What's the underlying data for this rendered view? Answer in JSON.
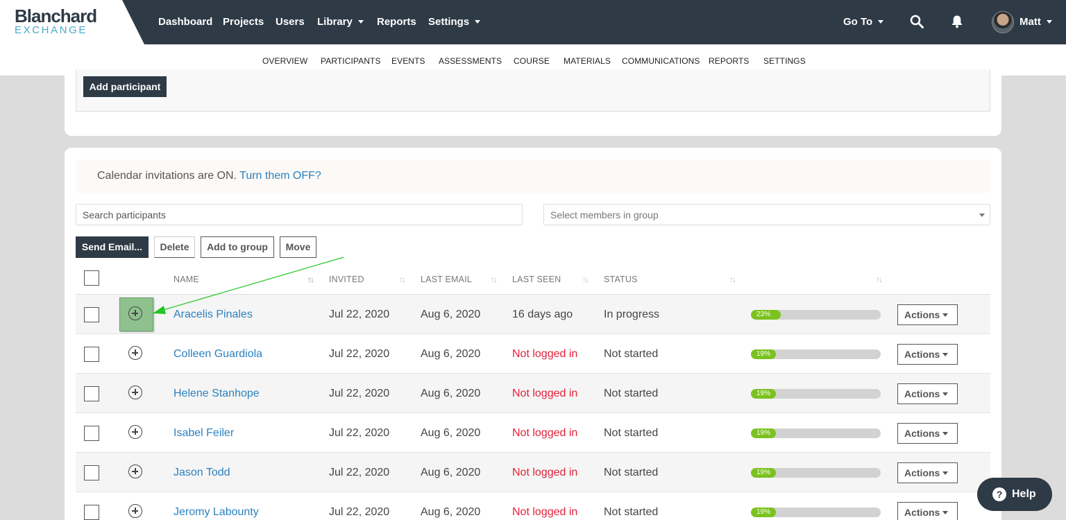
{
  "brand": {
    "name": "Blanchard",
    "sub": "EXCHANGE"
  },
  "topnav": {
    "items": [
      "Dashboard",
      "Projects",
      "Users",
      "Library",
      "Reports",
      "Settings"
    ],
    "goto": "Go To",
    "user": "Matt"
  },
  "subnav": {
    "items": [
      "OVERVIEW",
      "PARTICIPANTS",
      "EVENTS",
      "ASSESSMENTS",
      "COURSE",
      "MATERIALS",
      "COMMUNICATIONS",
      "REPORTS",
      "SETTINGS"
    ],
    "active": "PARTICIPANTS"
  },
  "add_participant": "Add participant",
  "notice": {
    "text": "Calendar invitations are ON.",
    "link": "Turn them OFF?"
  },
  "search": {
    "placeholder": "Search participants"
  },
  "group_select": {
    "placeholder": "Select members in group"
  },
  "toolbar": {
    "send_email": "Send Email...",
    "delete": "Delete",
    "add_to_group": "Add to group",
    "move": "Move"
  },
  "table": {
    "headers": {
      "name": "NAME",
      "invited": "INVITED",
      "last_email": "LAST EMAIL",
      "last_seen": "LAST SEEN",
      "status": "STATUS"
    },
    "rows": [
      {
        "name": "Aracelis Pinales",
        "invited": "Jul 22, 2020",
        "last_email": "Aug 6, 2020",
        "last_seen": "16 days ago",
        "status": "In progress",
        "progress_label": "23%",
        "progress": 23,
        "action": "Actions"
      },
      {
        "name": "Colleen Guardiola",
        "invited": "Jul 22, 2020",
        "last_email": "Aug 6, 2020",
        "last_seen": "Not logged in",
        "status": "Not started",
        "progress_label": "19%",
        "progress": 19,
        "action": "Actions"
      },
      {
        "name": "Helene Stanhope",
        "invited": "Jul 22, 2020",
        "last_email": "Aug 6, 2020",
        "last_seen": "Not logged in",
        "status": "Not started",
        "progress_label": "19%",
        "progress": 19,
        "action": "Actions"
      },
      {
        "name": "Isabel Feiler",
        "invited": "Jul 22, 2020",
        "last_email": "Aug 6, 2020",
        "last_seen": "Not logged in",
        "status": "Not started",
        "progress_label": "19%",
        "progress": 19,
        "action": "Actions"
      },
      {
        "name": "Jason Todd",
        "invited": "Jul 22, 2020",
        "last_email": "Aug 6, 2020",
        "last_seen": "Not logged in",
        "status": "Not started",
        "progress_label": "19%",
        "progress": 19,
        "action": "Actions"
      },
      {
        "name": "Jeromy Labounty",
        "invited": "Jul 22, 2020",
        "last_email": "Aug 6, 2020",
        "last_seen": "Not logged in",
        "status": "Not started",
        "progress_label": "19%",
        "progress": 19,
        "action": "Actions"
      }
    ]
  },
  "help": {
    "label": "Help",
    "icon": "?"
  },
  "colors": {
    "nav": "#2e3a46",
    "link": "#2a82c0",
    "progress": "#7bc21e",
    "not_logged": "#e0223a",
    "highlight": "#8fc18f",
    "arrow": "#22c522"
  }
}
